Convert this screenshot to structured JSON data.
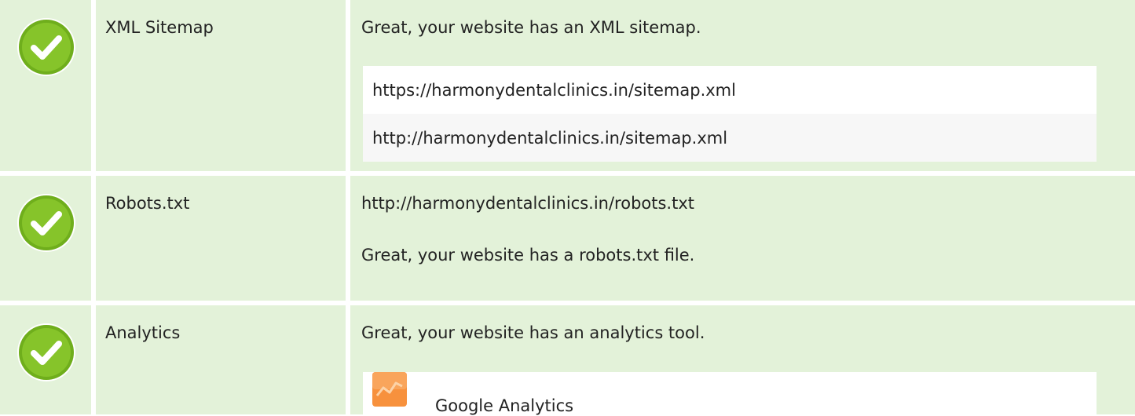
{
  "rows": [
    {
      "name": "XML Sitemap",
      "message": "Great, your website has an XML sitemap.",
      "urls": [
        "https://harmonydentalclinics.in/sitemap.xml",
        "http://harmonydentalclinics.in/sitemap.xml"
      ]
    },
    {
      "name": "Robots.txt",
      "url": "http://harmonydentalclinics.in/robots.txt",
      "message": "Great, your website has a robots.txt file."
    },
    {
      "name": "Analytics",
      "message": "Great, your website has an analytics tool.",
      "tools": [
        "Google Analytics"
      ]
    }
  ],
  "icons": {
    "status": "check-circle-icon",
    "tool": "google-analytics-icon"
  },
  "colors": {
    "row_bg": "#e3f2d9",
    "check_green": "#7cbd22",
    "analytics_orange": "#f7913d"
  }
}
